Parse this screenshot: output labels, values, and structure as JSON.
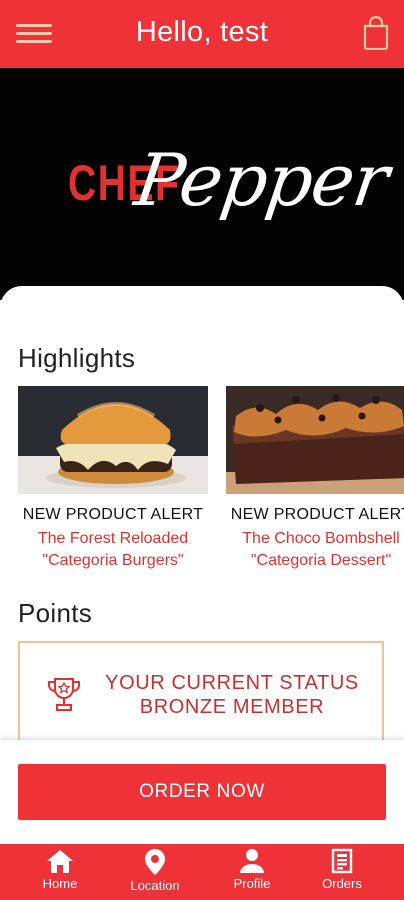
{
  "header": {
    "title": "Hello, test",
    "menu_icon": "hamburger-menu-icon",
    "bag_icon": "shopping-bag-icon"
  },
  "hero": {
    "logo_part1": "CHEF",
    "logo_part2": "Pepper"
  },
  "highlights": {
    "title": "Highlights",
    "items": [
      {
        "alert": "NEW PRODUCT ALERT",
        "name": "The Forest Reloaded",
        "category": "\"Categoria Burgers\"",
        "image": "burger-photo"
      },
      {
        "alert": "NEW PRODUCT ALERT",
        "name": "The Choco Bombshell",
        "category": "\"Categoria Dessert\"",
        "image": "chocolate-cake-photo"
      }
    ]
  },
  "points": {
    "title": "Points",
    "status_line1": "YOUR CURRENT STATUS",
    "status_line2": "BRONZE MEMBER",
    "icon": "trophy-icon"
  },
  "order": {
    "label": "ORDER NOW"
  },
  "nav": {
    "items": [
      {
        "label": "Home",
        "icon": "home-icon"
      },
      {
        "label": "Location",
        "icon": "location-pin-icon"
      },
      {
        "label": "Profile",
        "icon": "profile-icon"
      },
      {
        "label": "Orders",
        "icon": "orders-icon"
      }
    ]
  },
  "colors": {
    "brand_red": "#EE3237",
    "accent_peach": "#F0C39D",
    "text_red": "#E2312E"
  }
}
